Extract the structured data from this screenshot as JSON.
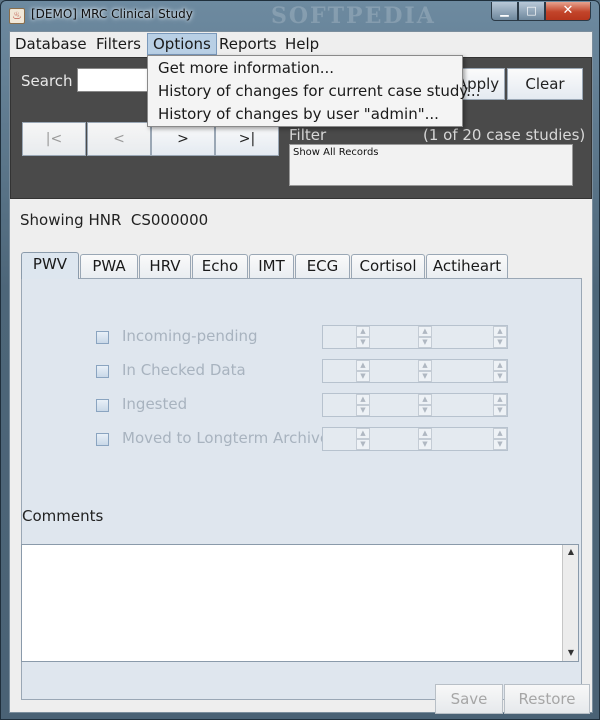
{
  "window": {
    "title": "[DEMO] MRC Clinical Study",
    "watermark": "SOFTPEDIA",
    "icon": "app-icon",
    "controls": {
      "minimize": "▁",
      "maximize": "□",
      "close": "✕"
    }
  },
  "menubar": {
    "items": [
      "Database",
      "Filters",
      "Options",
      "Reports",
      "Help"
    ],
    "open_menu": "Options"
  },
  "options_menu": {
    "items": [
      "Get more information...",
      "History of changes for current case study...",
      "History of changes by user \"admin\"..."
    ]
  },
  "search": {
    "label": "Search",
    "value": "",
    "apply_label": "Apply",
    "clear_label": "Clear"
  },
  "nav": {
    "first": "|<",
    "prev": "<",
    "next": ">",
    "last": ">|"
  },
  "filter": {
    "label": "Filter",
    "count": "(1 of 20 case studies)",
    "value": "Show All Records"
  },
  "record": {
    "showing_label": "Showing HNR",
    "id": "CS000000"
  },
  "tabs": [
    "PWV",
    "PWA",
    "HRV",
    "Echo",
    "IMT",
    "ECG",
    "Cortisol",
    "Actiheart"
  ],
  "active_tab": "PWV",
  "status_rows": [
    {
      "label": "Incoming-pending",
      "checked": false
    },
    {
      "label": "In Checked Data",
      "checked": false
    },
    {
      "label": "Ingested",
      "checked": false
    },
    {
      "label": "Moved to Longterm Archive",
      "checked": false
    }
  ],
  "comments": {
    "label": "Comments",
    "value": ""
  },
  "footer": {
    "save_label": "Save",
    "restore_label": "Restore"
  },
  "colors": {
    "window_border": "#4a6275",
    "panel_dark": "#4a4a4a",
    "menu_highlight": "#b8cfe5",
    "tab_active": "#dde6ef",
    "disabled_text": "#a8b3bf"
  }
}
